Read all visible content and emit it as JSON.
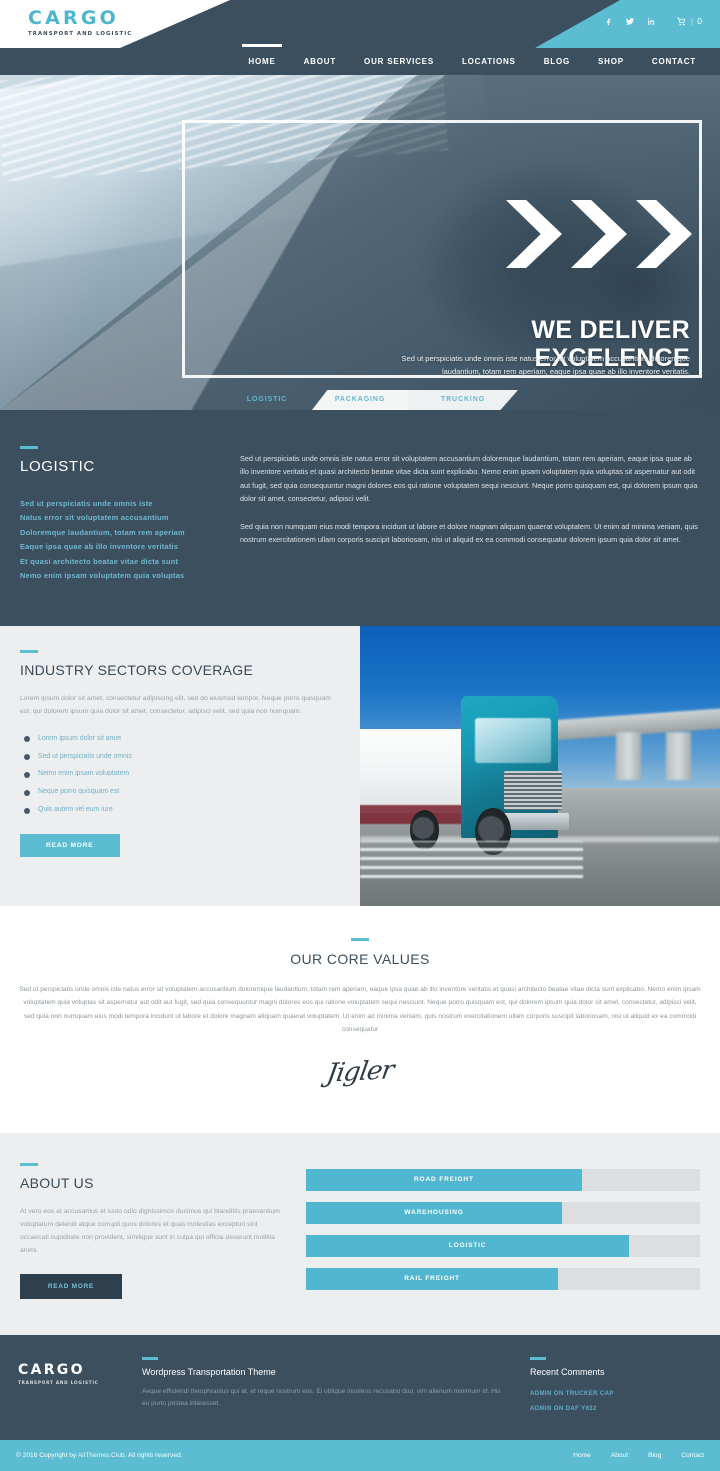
{
  "theme": {
    "accent": "#5bbcd2",
    "dark": "#3c4f5f",
    "light_grey": "#eceeef"
  },
  "header": {
    "logo": {
      "main": "CARGO",
      "sub": "TRANSPORT AND LOGISTIC"
    },
    "social": [
      {
        "name": "facebook-icon",
        "glyph": "f"
      },
      {
        "name": "twitter-icon",
        "glyph": "✒"
      },
      {
        "name": "linkedin-icon",
        "glyph": "in"
      }
    ],
    "cart": {
      "icon": "cart-icon",
      "separator": "|",
      "count": "0"
    },
    "nav": [
      {
        "label": "HOME",
        "active": true
      },
      {
        "label": "ABOUT",
        "active": false
      },
      {
        "label": "OUR SERVICES",
        "active": false
      },
      {
        "label": "LOCATIONS",
        "active": false
      },
      {
        "label": "BLOG",
        "active": false
      },
      {
        "label": "SHOP",
        "active": false
      },
      {
        "label": "CONTACT",
        "active": false
      }
    ]
  },
  "hero": {
    "title": "WE DELIVER EXCELENCE",
    "subtitle": "Sed ut perspiciatis unde omnis iste natus error sit voluptatem accusantium doloremque laudantium, totam rem aperiam, eaque ipsa quae ab illo inventore veritatis.",
    "chevron_count": 3,
    "tabs": [
      {
        "label": "LOGISTIC",
        "active": true
      },
      {
        "label": "PACKAGING",
        "active": false
      },
      {
        "label": "TRUCKING",
        "active": false
      }
    ]
  },
  "logistic": {
    "title": "LOGISTIC",
    "highlights": [
      "Sed ut perspiciatis unde omnis iste",
      "Natus error sit voluptatem accusantium",
      "Doloremque laudantium, totam rem aperiam",
      "Eaque ipsa quae ab illo inventore veritatis",
      "Et quasi architecto beatae vitae dicta sunt",
      "Nemo enim ipsam voluptatem quia voluptas"
    ],
    "paragraph1": "Sed ut perspiciatis unde omnis iste natus error sit voluptatem accusantium doloremque laudantium, totam rem aperiam, eaque ipsa quae ab illo inventore veritatis et quasi architecto beatae vitae dicta sunt explicabo. Nemo enim ipsam voluptatem quia voluptas sit aspernatur aut odit aut fugit, sed quia consequuntur magni dolores eos qui ratione voluptatem sequi nesciunt. Neque porro quisquam est, qui dolorem ipsum quia dolor sit amet, consectetur, adipisci velit.",
    "paragraph2": "Sed quia non numquam eius modi tempora incidunt ut labore et dolore magnam aliquam quaerat voluptatem. Ut enim ad minima veniam, quis nostrum exercitationem ullam corporis suscipit laboriosam, nisi ut aliquid ex ea commodi consequatur dolorem ipsum quia dolor sit amet."
  },
  "sectors": {
    "title": "INDUSTRY SECTORS COVERAGE",
    "paragraph": "Lorem ipsum dolor sit amet, consectetur adipiscing elit, sed do eiusmod tempor. Neque porro quisquam est, qui dolorem ipsum quia dolor sit amet, consectetur, adipisci velit, sed quia non numquam.",
    "items": [
      "Lorem ipsum dolor sit amet",
      "Sed ut perspiciatis unde omnis",
      "Nemo enim ipsam voluptatem",
      "Neque porro quisquam est",
      "Quis autem vel eum iure"
    ],
    "button": "READ MORE",
    "image_alt": "teal-truck-on-highway"
  },
  "core_values": {
    "title": "OUR CORE VALUES",
    "paragraph": "Sed ut perspiciatis unde omnis iste natus error sit voluptatem accusantium doloremque laudantium, totam rem aperiam, eaque ipsa quae ab illo inventore veritatis et quasi architecto beatae vitae dicta sunt explicabo. Nemo enim ipsam voluptatem quia voluptas sit aspernatur aut odit aut fugit, sed quia consequuntur magni dolores eos qui ratione voluptatem sequi nesciunt. Neque porro quisquam est, qui dolorem ipsum quia dolor sit amet, consectetur, adipisci velit, sed quia non numquam eius modi tempora incidunt ut labore et dolore magnam aliquam quaerat voluptatem. Ut enim ad minima veniam, quis nostrum exercitationem ullam corporis suscipit laboriosam, nisi ut aliquid ex ea commodi consequatur",
    "signature": "Jigler"
  },
  "about": {
    "title": "ABOUT US",
    "paragraph": "At vero eos et accusamus et iusto odio dignissimos ducimus qui blanditiis praesentium voluptatum deleniti atque corrupti quos dolores et quas molestias excepturi sint occaecati cupiditate non provident, similique sunt in culpa qui officia deserunt mollitia animi.",
    "button": "READ MORE",
    "skills": [
      {
        "label": "ROAD FREIGHT",
        "percent": 70
      },
      {
        "label": "WAREHOUSING",
        "percent": 65
      },
      {
        "label": "LOGISTIC",
        "percent": 82
      },
      {
        "label": "RAIL FREIGHT",
        "percent": 64
      }
    ]
  },
  "footer": {
    "logo": {
      "main": "CARGO",
      "sub": "TRANSPORT AND LOGISTIC"
    },
    "middle": {
      "heading": "Wordpress Transportation Theme",
      "text": "Aeque efficiendi theophrastus qui at, et reque nostrum eos. Ei oblique insolens recusabo duo, vim alienum minimum id. His eu purto postea interesset."
    },
    "recent": {
      "heading": "Recent Comments",
      "items": [
        "ADMIN ON TRUCKER CAP",
        "ADMIN ON DAF Y632"
      ]
    }
  },
  "copyright": {
    "text_before": "© 2016 Copyright by ",
    "brand": "AitThemes.Club",
    "text_after": ". All rights reserved.",
    "links": [
      "Home",
      "About",
      "Blog",
      "Contact"
    ]
  }
}
